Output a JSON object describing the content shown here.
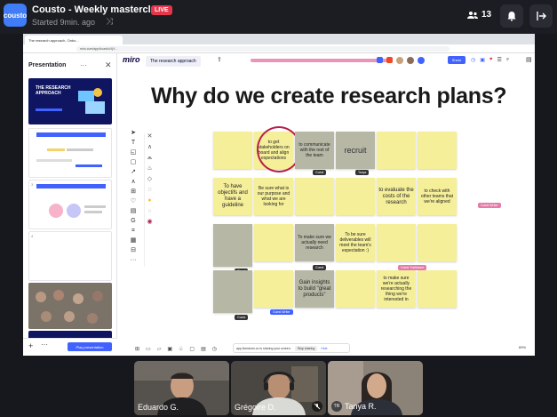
{
  "app": {
    "logo_text": "cousto",
    "title": "Cousto - Weekly masterclass",
    "live_badge": "LIVE",
    "subtitle": "Started 9min. ago",
    "viewer_count": "13"
  },
  "browser": {
    "tab_title": "The research approach, Onbo...",
    "url": "miro.com/app/board/uXjV..."
  },
  "presentation": {
    "header": "Presentation",
    "slide1_title": "THE RESEARCH APPROACH",
    "play_label": "Play presentation"
  },
  "board": {
    "logo": "miro",
    "name": "The research approach",
    "share_label": "Share",
    "heading": "Why do we create research plans?",
    "zoom": "69%",
    "notes": [
      {
        "text": "to get stakeholders on board and align expectations",
        "color": "yellow"
      },
      {
        "text": "to communicate with the rest of the team",
        "color": "grey"
      },
      {
        "text": "recruit",
        "color": "grey"
      },
      {
        "text": "To have objectifs and have a guideline",
        "color": "yellow"
      },
      {
        "text": "Be sure what is our purpose and what we are looking for",
        "color": "yellow"
      },
      {
        "text": "to evaluate the costs of the research",
        "color": "yellow"
      },
      {
        "text": "to check with other teams that we're aligned",
        "color": "yellow"
      },
      {
        "text": "To make sure we actually need research",
        "color": "grey"
      },
      {
        "text": "To be sure deliverables will meet the team's expectation :)",
        "color": "yellow"
      },
      {
        "text": "Gain insights to build \"great products\"",
        "color": "grey"
      },
      {
        "text": "to make sure we're actually researching the thing we're interested in",
        "color": "yellow"
      }
    ],
    "tags": {
      "guest1": "Guest",
      "guest2": "Guest",
      "guest3": "Guest",
      "guest4": "Guest",
      "tanya": "Tanya",
      "cursor1": "Guest Trailblazer",
      "cursor2": "Guest Writer",
      "cursor3": "Guest Writer"
    },
    "sharing_text": "app.livestorm.co is sharing your screen.",
    "stop_label": "Stop sharing",
    "hide_label": "Hide"
  },
  "participants": [
    {
      "name": "Eduardo G."
    },
    {
      "name": "Grégoire D."
    },
    {
      "name": "Tanya R.",
      "initials": "TR"
    }
  ],
  "colors": {
    "accent": "#4262ff",
    "live": "#e5364b",
    "sticky_yellow": "#f5ef9a",
    "sticky_grey": "#b7b7a6",
    "marker": "#b81f4a"
  }
}
